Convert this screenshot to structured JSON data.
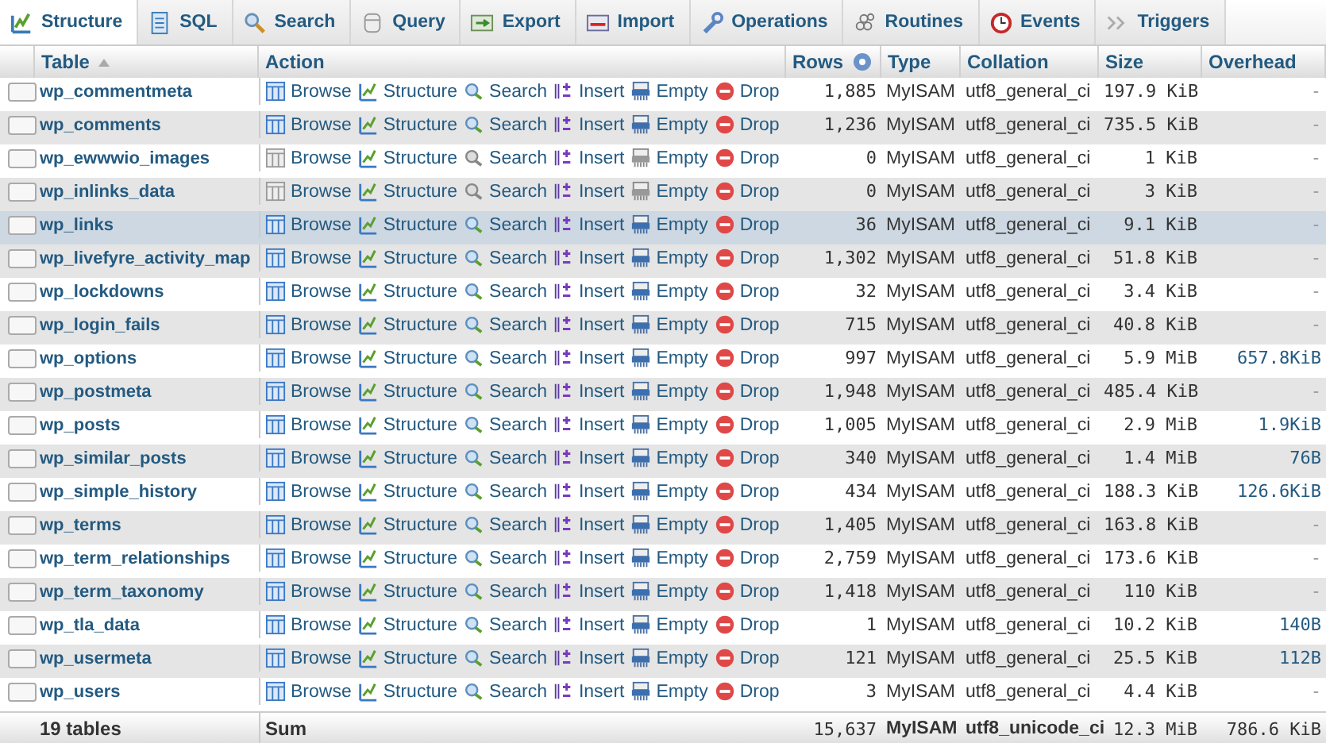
{
  "tabs": [
    {
      "label": "Structure",
      "selected": true
    },
    {
      "label": "SQL",
      "selected": false
    },
    {
      "label": "Search",
      "selected": false
    },
    {
      "label": "Query",
      "selected": false
    },
    {
      "label": "Export",
      "selected": false
    },
    {
      "label": "Import",
      "selected": false
    },
    {
      "label": "Operations",
      "selected": false
    },
    {
      "label": "Routines",
      "selected": false
    },
    {
      "label": "Events",
      "selected": false
    },
    {
      "label": "Triggers",
      "selected": false
    }
  ],
  "columns": [
    "Table",
    "Action",
    "Rows",
    "Type",
    "Collation",
    "Size",
    "Overhead"
  ],
  "rows": [
    {
      "name": "wp_commentmeta",
      "checked": false,
      "highlighted": false,
      "empty": false,
      "actions": [
        "Browse",
        "Structure",
        "Search",
        "Insert",
        "Empty",
        "Drop"
      ],
      "rows": "1,885",
      "type": "MyISAM",
      "collation": "utf8_general_ci",
      "size": "197.9 KiB",
      "overhead": "-",
      "overhead_link": false
    },
    {
      "name": "wp_comments",
      "checked": false,
      "highlighted": false,
      "empty": false,
      "actions": [
        "Browse",
        "Structure",
        "Search",
        "Insert",
        "Empty",
        "Drop"
      ],
      "rows": "1,236",
      "type": "MyISAM",
      "collation": "utf8_general_ci",
      "size": "735.5 KiB",
      "overhead": "-",
      "overhead_link": false
    },
    {
      "name": "wp_ewwwio_images",
      "checked": false,
      "highlighted": false,
      "empty": true,
      "actions": [
        "Browse",
        "Structure",
        "Search",
        "Insert",
        "Empty",
        "Drop"
      ],
      "rows": "0",
      "type": "MyISAM",
      "collation": "utf8_general_ci",
      "size": "1 KiB",
      "overhead": "-",
      "overhead_link": false
    },
    {
      "name": "wp_inlinks_data",
      "checked": false,
      "highlighted": false,
      "empty": true,
      "actions": [
        "Browse",
        "Structure",
        "Search",
        "Insert",
        "Empty",
        "Drop"
      ],
      "rows": "0",
      "type": "MyISAM",
      "collation": "utf8_general_ci",
      "size": "3 KiB",
      "overhead": "-",
      "overhead_link": false
    },
    {
      "name": "wp_links",
      "checked": false,
      "highlighted": true,
      "empty": false,
      "actions": [
        "Browse",
        "Structure",
        "Search",
        "Insert",
        "Empty",
        "Drop"
      ],
      "rows": "36",
      "type": "MyISAM",
      "collation": "utf8_general_ci",
      "size": "9.1 KiB",
      "overhead": "-",
      "overhead_link": false
    },
    {
      "name": "wp_livefyre_activity_map",
      "checked": false,
      "highlighted": false,
      "empty": false,
      "actions": [
        "Browse",
        "Structure",
        "Search",
        "Insert",
        "Empty",
        "Drop"
      ],
      "rows": "1,302",
      "type": "MyISAM",
      "collation": "utf8_general_ci",
      "size": "51.8 KiB",
      "overhead": "-",
      "overhead_link": false
    },
    {
      "name": "wp_lockdowns",
      "checked": false,
      "highlighted": false,
      "empty": false,
      "actions": [
        "Browse",
        "Structure",
        "Search",
        "Insert",
        "Empty",
        "Drop"
      ],
      "rows": "32",
      "type": "MyISAM",
      "collation": "utf8_general_ci",
      "size": "3.4 KiB",
      "overhead": "-",
      "overhead_link": false
    },
    {
      "name": "wp_login_fails",
      "checked": false,
      "highlighted": false,
      "empty": false,
      "actions": [
        "Browse",
        "Structure",
        "Search",
        "Insert",
        "Empty",
        "Drop"
      ],
      "rows": "715",
      "type": "MyISAM",
      "collation": "utf8_general_ci",
      "size": "40.8 KiB",
      "overhead": "-",
      "overhead_link": false
    },
    {
      "name": "wp_options",
      "checked": false,
      "highlighted": false,
      "empty": false,
      "actions": [
        "Browse",
        "Structure",
        "Search",
        "Insert",
        "Empty",
        "Drop"
      ],
      "rows": "997",
      "type": "MyISAM",
      "collation": "utf8_general_ci",
      "size": "5.9 MiB",
      "overhead": "657.8KiB",
      "overhead_link": true
    },
    {
      "name": "wp_postmeta",
      "checked": false,
      "highlighted": false,
      "empty": false,
      "actions": [
        "Browse",
        "Structure",
        "Search",
        "Insert",
        "Empty",
        "Drop"
      ],
      "rows": "1,948",
      "type": "MyISAM",
      "collation": "utf8_general_ci",
      "size": "485.4 KiB",
      "overhead": "-",
      "overhead_link": false
    },
    {
      "name": "wp_posts",
      "checked": false,
      "highlighted": false,
      "empty": false,
      "actions": [
        "Browse",
        "Structure",
        "Search",
        "Insert",
        "Empty",
        "Drop"
      ],
      "rows": "1,005",
      "type": "MyISAM",
      "collation": "utf8_general_ci",
      "size": "2.9 MiB",
      "overhead": "1.9KiB",
      "overhead_link": true
    },
    {
      "name": "wp_similar_posts",
      "checked": false,
      "highlighted": false,
      "empty": false,
      "actions": [
        "Browse",
        "Structure",
        "Search",
        "Insert",
        "Empty",
        "Drop"
      ],
      "rows": "340",
      "type": "MyISAM",
      "collation": "utf8_general_ci",
      "size": "1.4 MiB",
      "overhead": "76B",
      "overhead_link": true
    },
    {
      "name": "wp_simple_history",
      "checked": false,
      "highlighted": false,
      "empty": false,
      "actions": [
        "Browse",
        "Structure",
        "Search",
        "Insert",
        "Empty",
        "Drop"
      ],
      "rows": "434",
      "type": "MyISAM",
      "collation": "utf8_general_ci",
      "size": "188.3 KiB",
      "overhead": "126.6KiB",
      "overhead_link": true
    },
    {
      "name": "wp_terms",
      "checked": false,
      "highlighted": false,
      "empty": false,
      "actions": [
        "Browse",
        "Structure",
        "Search",
        "Insert",
        "Empty",
        "Drop"
      ],
      "rows": "1,405",
      "type": "MyISAM",
      "collation": "utf8_general_ci",
      "size": "163.8 KiB",
      "overhead": "-",
      "overhead_link": false
    },
    {
      "name": "wp_term_relationships",
      "checked": false,
      "highlighted": false,
      "empty": false,
      "actions": [
        "Browse",
        "Structure",
        "Search",
        "Insert",
        "Empty",
        "Drop"
      ],
      "rows": "2,759",
      "type": "MyISAM",
      "collation": "utf8_general_ci",
      "size": "173.6 KiB",
      "overhead": "-",
      "overhead_link": false
    },
    {
      "name": "wp_term_taxonomy",
      "checked": false,
      "highlighted": false,
      "empty": false,
      "actions": [
        "Browse",
        "Structure",
        "Search",
        "Insert",
        "Empty",
        "Drop"
      ],
      "rows": "1,418",
      "type": "MyISAM",
      "collation": "utf8_general_ci",
      "size": "110 KiB",
      "overhead": "-",
      "overhead_link": false
    },
    {
      "name": "wp_tla_data",
      "checked": false,
      "highlighted": false,
      "empty": false,
      "actions": [
        "Browse",
        "Structure",
        "Search",
        "Insert",
        "Empty",
        "Drop"
      ],
      "rows": "1",
      "type": "MyISAM",
      "collation": "utf8_general_ci",
      "size": "10.2 KiB",
      "overhead": "140B",
      "overhead_link": true
    },
    {
      "name": "wp_usermeta",
      "checked": false,
      "highlighted": false,
      "empty": false,
      "actions": [
        "Browse",
        "Structure",
        "Search",
        "Insert",
        "Empty",
        "Drop"
      ],
      "rows": "121",
      "type": "MyISAM",
      "collation": "utf8_general_ci",
      "size": "25.5 KiB",
      "overhead": "112B",
      "overhead_link": true
    },
    {
      "name": "wp_users",
      "checked": false,
      "highlighted": false,
      "empty": false,
      "actions": [
        "Browse",
        "Structure",
        "Search",
        "Insert",
        "Empty",
        "Drop"
      ],
      "rows": "3",
      "type": "MyISAM",
      "collation": "utf8_general_ci",
      "size": "4.4 KiB",
      "overhead": "-",
      "overhead_link": false
    }
  ],
  "footer": {
    "tables": "19 tables",
    "action": "Sum",
    "rows": "15,637",
    "type": "MyISAM",
    "collation": "utf8_unicode_ci",
    "size": "12.3 MiB",
    "overhead": "786.6 KiB"
  }
}
